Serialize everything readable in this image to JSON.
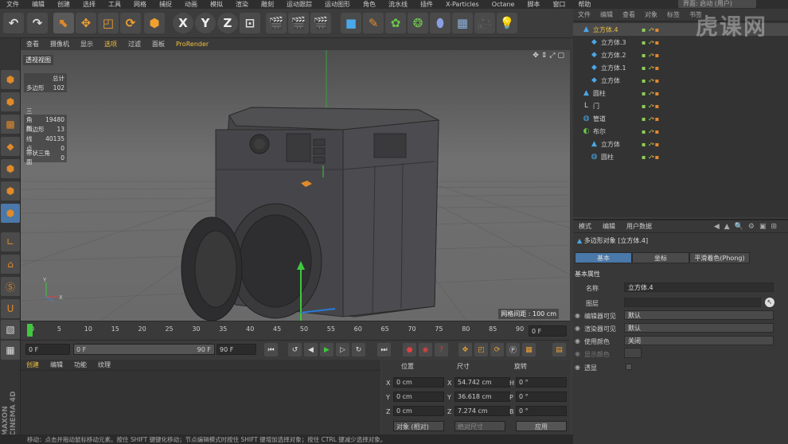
{
  "menubar": {
    "items": [
      "文件",
      "编辑",
      "创建",
      "选择",
      "工具",
      "网格",
      "捕捉",
      "动画",
      "模拟",
      "渲染",
      "雕刻",
      "运动跟踪",
      "运动图形",
      "角色",
      "流水线",
      "插件",
      "X-Particles",
      "Octane",
      "脚本",
      "窗口",
      "帮助"
    ],
    "layout_label": "界面: 启动 (用户)"
  },
  "viewport_menu": {
    "items": [
      "查看",
      "摄像机",
      "显示",
      "选项",
      "过滤",
      "面板",
      "ProRender"
    ]
  },
  "viewport": {
    "label": "透视视图",
    "stats_header": "总计",
    "stats": [
      {
        "k": "多边形",
        "v": "102"
      },
      {
        "k": "三角形",
        "v": "19480"
      },
      {
        "k": "四边形",
        "v": "13"
      },
      {
        "k": "线",
        "v": "40135"
      },
      {
        "k": "点",
        "v": "0"
      },
      {
        "k": "带状三角面",
        "v": "0"
      }
    ],
    "grid_spacing": "网格间距 : 100 cm"
  },
  "timeline": {
    "ticks": [
      "0",
      "5",
      "10",
      "15",
      "20",
      "25",
      "30",
      "35",
      "40",
      "45",
      "50",
      "55",
      "60",
      "65",
      "70",
      "75",
      "80",
      "85",
      "90"
    ],
    "frame_field": "0 F"
  },
  "playbar": {
    "start_field": "0 F",
    "range_start": "0 F",
    "range_end": "90 F",
    "end_field": "90 F"
  },
  "material_menu": {
    "items": [
      "创建",
      "编辑",
      "功能",
      "纹理"
    ]
  },
  "coords": {
    "headers": [
      "位置",
      "尺寸",
      "旋转"
    ],
    "rows": [
      {
        "axis": "X",
        "pos": "0 cm",
        "size": "54.742 cm",
        "rlabel": "H",
        "rot": "0 °"
      },
      {
        "axis": "Y",
        "pos": "0 cm",
        "size": "36.618 cm",
        "rlabel": "P",
        "rot": "0 °"
      },
      {
        "axis": "Z",
        "pos": "0 cm",
        "size": "7.274 cm",
        "rlabel": "B",
        "rot": "0 °"
      }
    ],
    "mode": "对象 (相对)",
    "size_mode": "绝对尺寸",
    "apply": "应用"
  },
  "statusbar": {
    "text": "移动：点击并拖动鼠标移动元素。按住 SHIFT 键键化移动；节点编辑模式时按住 SHIFT 键增加选择对象；按住 CTRL 键减少选择对象。"
  },
  "objects_menu": {
    "items": [
      "文件",
      "编辑",
      "查看",
      "对象",
      "标签",
      "书签"
    ]
  },
  "objects": [
    {
      "name": "立方体.4",
      "indent": 0,
      "icon": "cone",
      "selected": true
    },
    {
      "name": "立方体.3",
      "indent": 1,
      "icon": "cube"
    },
    {
      "name": "立方体.2",
      "indent": 1,
      "icon": "cube"
    },
    {
      "name": "立方体.1",
      "indent": 1,
      "icon": "cube"
    },
    {
      "name": "立方体",
      "indent": 1,
      "icon": "cube"
    },
    {
      "name": "圆柱",
      "indent": 0,
      "icon": "cone"
    },
    {
      "name": "门",
      "indent": 0,
      "icon": "null"
    },
    {
      "name": "管道",
      "indent": 0,
      "icon": "cyl"
    },
    {
      "name": "布尔",
      "indent": 0,
      "icon": "bool"
    },
    {
      "name": "立方体",
      "indent": 1,
      "icon": "cone"
    },
    {
      "name": "圆柱",
      "indent": 1,
      "icon": "cyl"
    }
  ],
  "attr_menu": {
    "items": [
      "模式",
      "编辑",
      "用户数据"
    ]
  },
  "attr": {
    "title": "多边形对象 [立方体.4]",
    "tabs": [
      "基本",
      "坐标",
      "平滑着色(Phong)"
    ],
    "section": "基本属性",
    "props": [
      {
        "label": "名称",
        "value": "立方体.4"
      },
      {
        "label": "图层",
        "value": ""
      },
      {
        "label": "编辑器可见",
        "value": "默认"
      },
      {
        "label": "渲染器可见",
        "value": "默认"
      },
      {
        "label": "使用颜色",
        "value": "关闭"
      },
      {
        "label": "显示颜色",
        "value": ""
      },
      {
        "label": "透显",
        "value": ""
      }
    ]
  },
  "watermark": "虎课网",
  "brand": "MAXON CINEMA 4D"
}
